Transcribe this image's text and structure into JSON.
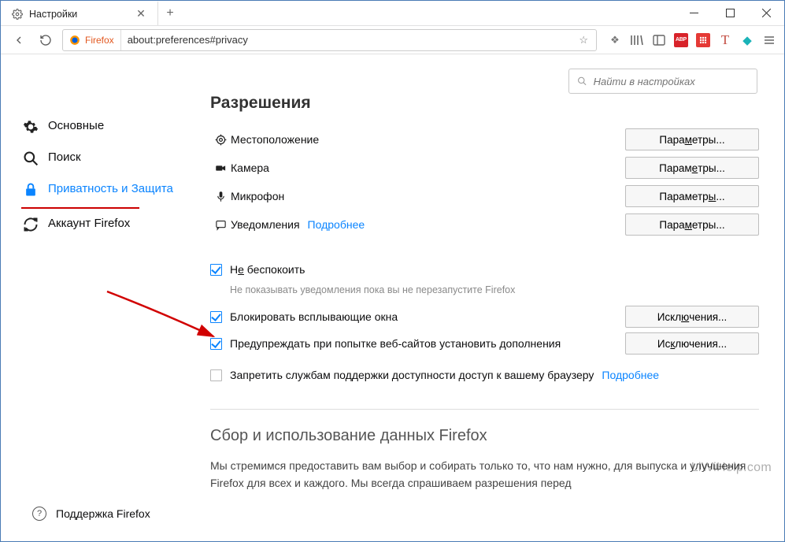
{
  "window": {
    "tab_title": "Настройки",
    "url_identity": "Firefox",
    "url": "about:preferences#privacy"
  },
  "search": {
    "placeholder": "Найти в настройках"
  },
  "sidebar": {
    "items": [
      {
        "label": "Основные"
      },
      {
        "label": "Поиск"
      },
      {
        "label": "Приватность и Защита"
      },
      {
        "label": "Аккаунт Firefox"
      }
    ]
  },
  "support": {
    "label": "Поддержка Firefox"
  },
  "permissions": {
    "title": "Разрешения",
    "rows": [
      {
        "label": "Местоположение",
        "button": "Параметры..."
      },
      {
        "label": "Камера",
        "button": "Параметры..."
      },
      {
        "label": "Микрофон",
        "button": "Параметры..."
      },
      {
        "label": "Уведомления",
        "link": "Подробнее",
        "button": "Параметры..."
      }
    ]
  },
  "checks": {
    "dnd": {
      "label": "Не беспокоить",
      "desc": "Не показывать уведомления пока вы не перезапустите Firefox"
    },
    "popup": {
      "label": "Блокировать всплывающие окна",
      "button": "Исключения..."
    },
    "addons": {
      "label": "Предупреждать при попытке веб-сайтов установить дополнения",
      "button": "Исключения..."
    },
    "a11y": {
      "label": "Запретить службам поддержки доступности доступ к вашему браузеру",
      "link": "Подробнее"
    }
  },
  "data_section": {
    "title": "Сбор и использование данных Firefox",
    "body": "Мы стремимся предоставить вам выбор и собирать только то, что нам нужно, для выпуска и улучшения Firefox для всех и каждого. Мы всегда спрашиваем разрешения перед"
  },
  "watermark": "LiWiHelp.com"
}
